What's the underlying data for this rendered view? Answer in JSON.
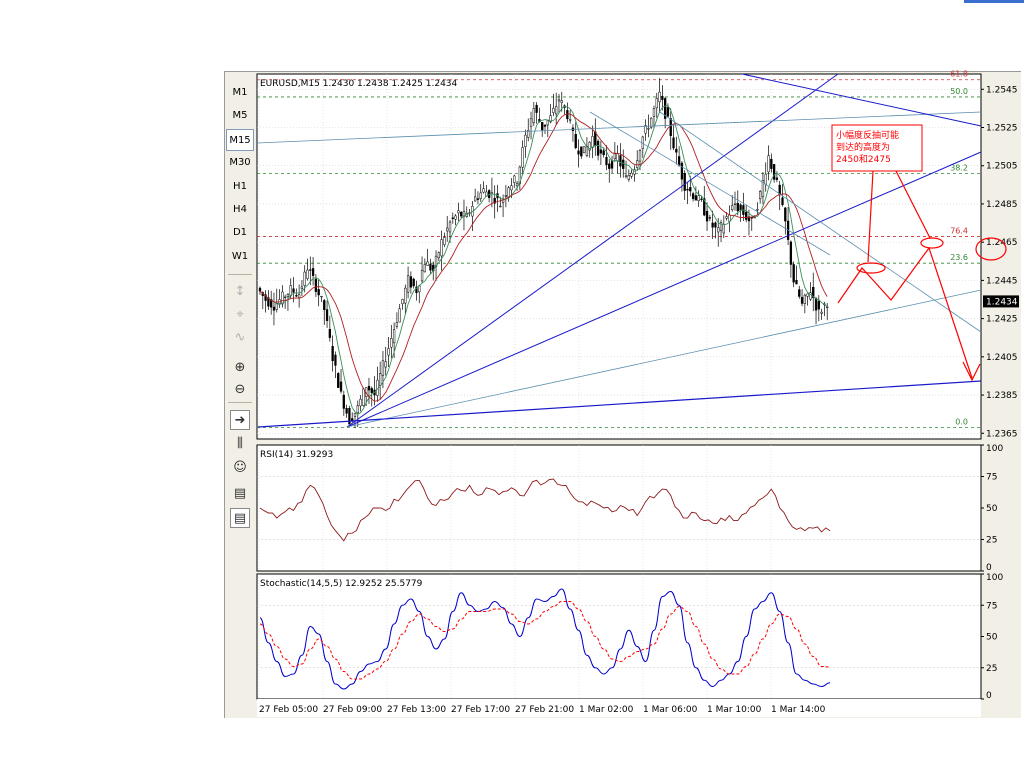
{
  "timeframes": [
    "M1",
    "M5",
    "M15",
    "M30",
    "H1",
    "H4",
    "D1",
    "W1"
  ],
  "active_timeframe": "M15",
  "tool_icons": [
    "cursor-icon",
    "crosshair-icon",
    "line-tool-icon",
    "zoom-in-icon",
    "zoom-out-icon",
    "autoscroll-icon",
    "chart-shift-icon",
    "expert-icon",
    "template-icon",
    "period-icon"
  ],
  "main": {
    "header": "EURUSD,M15  1.2430 1.2438 1.2425 1.2434",
    "price_labels": [
      {
        "value": 1.2545,
        "label": "1.2545"
      },
      {
        "value": 1.2525,
        "label": "1.2525"
      },
      {
        "value": 1.2505,
        "label": "1.2505"
      },
      {
        "value": 1.2485,
        "label": "1.2485"
      },
      {
        "value": 1.2465,
        "label": "1.2465"
      },
      {
        "value": 1.2445,
        "label": "1.2445"
      },
      {
        "value": 1.2425,
        "label": "1.2425"
      },
      {
        "value": 1.2405,
        "label": "1.2405"
      },
      {
        "value": 1.2385,
        "label": "1.2385"
      },
      {
        "value": 1.2365,
        "label": "1.2365"
      }
    ],
    "current_price": {
      "value": 1.2434,
      "label": "1.2434"
    },
    "fib_levels": [
      {
        "label": "61.8",
        "value": 1.255,
        "color": "#cc3333"
      },
      {
        "label": "50.0",
        "value": 1.2541,
        "color": "#338833"
      },
      {
        "label": "38.2",
        "value": 1.2501,
        "color": "#338833"
      },
      {
        "label": "76.4",
        "value": 1.2468,
        "color": "#cc3333"
      },
      {
        "label": "23.6",
        "value": 1.2454,
        "color": "#338833"
      },
      {
        "label": "0.0",
        "value": 1.2368,
        "color": "#338833"
      }
    ],
    "annotation": {
      "lines": [
        "小幅度反抽可能",
        "到达的高度为",
        "2450和2475"
      ],
      "color": "#ff0000"
    }
  },
  "x_axis_labels": [
    "27 Feb 05:00",
    "27 Feb 09:00",
    "27 Feb 13:00",
    "27 Feb 17:00",
    "27 Feb 21:00",
    "1 Mar 02:00",
    "1 Mar 06:00",
    "1 Mar 10:00",
    "1 Mar 14:00"
  ],
  "rsi": {
    "header": "RSI(14)  31.9293",
    "labels": [
      "100",
      "75",
      "50",
      "25",
      "0"
    ]
  },
  "stoch": {
    "header": "Stochastic(14,5,5)  12.9252  25.5779",
    "labels": [
      "100",
      "75",
      "50",
      "25",
      "0"
    ]
  },
  "chart_data": [
    {
      "type": "candlestick",
      "title": "EURUSD,M15",
      "ylim": [
        1.2362,
        1.2553
      ],
      "xlabel": "",
      "ylabel": "",
      "x": [
        "27 Feb 05:00",
        "27 Feb 09:00",
        "27 Feb 13:00",
        "27 Feb 17:00",
        "27 Feb 21:00",
        "1 Mar 02:00",
        "1 Mar 06:00",
        "1 Mar 10:00",
        "1 Mar 14:00"
      ],
      "close_path": [
        1.2441,
        1.2435,
        1.2432,
        1.2436,
        1.244,
        1.2438,
        1.2452,
        1.2442,
        1.243,
        1.2405,
        1.2385,
        1.2372,
        1.2378,
        1.239,
        1.2385,
        1.24,
        1.2415,
        1.243,
        1.2445,
        1.244,
        1.2455,
        1.245,
        1.2465,
        1.2475,
        1.248,
        1.2478,
        1.2488,
        1.2492,
        1.249,
        1.2485,
        1.2495,
        1.2498,
        1.252,
        1.2535,
        1.2525,
        1.253,
        1.254,
        1.2532,
        1.2515,
        1.2512,
        1.252,
        1.251,
        1.2505,
        1.251,
        1.2498,
        1.2505,
        1.252,
        1.253,
        1.2542,
        1.2528,
        1.251,
        1.2495,
        1.249,
        1.2485,
        1.2475,
        1.247,
        1.2478,
        1.2485,
        1.248,
        1.2475,
        1.249,
        1.251,
        1.2495,
        1.2475,
        1.2445,
        1.2432,
        1.244,
        1.2428,
        1.2434
      ],
      "series": [
        {
          "name": "",
          "kind": "ma-fast",
          "color": "#3a8f5a"
        },
        {
          "name": "",
          "kind": "ma-slow",
          "color": "#b02020"
        }
      ]
    },
    {
      "type": "line",
      "title": "RSI(14)",
      "ylim": [
        0,
        100
      ],
      "values": [
        50,
        46,
        42,
        47,
        48,
        55,
        68,
        60,
        44,
        32,
        24,
        30,
        40,
        45,
        50,
        48,
        57,
        60,
        68,
        72,
        58,
        52,
        56,
        62,
        64,
        68,
        60,
        66,
        64,
        63,
        66,
        60,
        65,
        72,
        70,
        73,
        68,
        62,
        55,
        52,
        54,
        50,
        47,
        52,
        48,
        44,
        55,
        58,
        65,
        60,
        48,
        42,
        46,
        40,
        38,
        42,
        44,
        40,
        46,
        52,
        58,
        65,
        50,
        40,
        33,
        32,
        34,
        31,
        32
      ]
    },
    {
      "type": "line",
      "title": "Stochastic(14,5,5)",
      "ylim": [
        0,
        100
      ],
      "series": [
        {
          "name": "",
          "color": "#0000cc",
          "values": [
            65,
            45,
            30,
            18,
            20,
            35,
            58,
            52,
            30,
            12,
            8,
            12,
            22,
            28,
            30,
            40,
            60,
            75,
            80,
            70,
            50,
            40,
            48,
            70,
            85,
            75,
            70,
            72,
            78,
            73,
            60,
            50,
            65,
            80,
            78,
            82,
            88,
            72,
            55,
            35,
            25,
            20,
            25,
            40,
            55,
            42,
            30,
            55,
            82,
            86,
            75,
            45,
            25,
            15,
            10,
            15,
            20,
            30,
            50,
            72,
            78,
            85,
            70,
            45,
            20,
            15,
            12,
            10,
            13
          ]
        },
        {
          "name": "",
          "color": "#ff0000",
          "dashed": true,
          "values": [
            60,
            52,
            42,
            32,
            26,
            28,
            40,
            48,
            42,
            32,
            22,
            16,
            16,
            20,
            24,
            30,
            40,
            52,
            62,
            68,
            64,
            58,
            54,
            56,
            64,
            70,
            70,
            70,
            72,
            72,
            68,
            62,
            60,
            64,
            70,
            74,
            78,
            78,
            72,
            62,
            50,
            40,
            32,
            30,
            34,
            38,
            40,
            44,
            56,
            68,
            74,
            70,
            58,
            44,
            32,
            24,
            20,
            20,
            26,
            36,
            48,
            60,
            68,
            66,
            56,
            44,
            34,
            26,
            25.6
          ]
        }
      ]
    }
  ]
}
